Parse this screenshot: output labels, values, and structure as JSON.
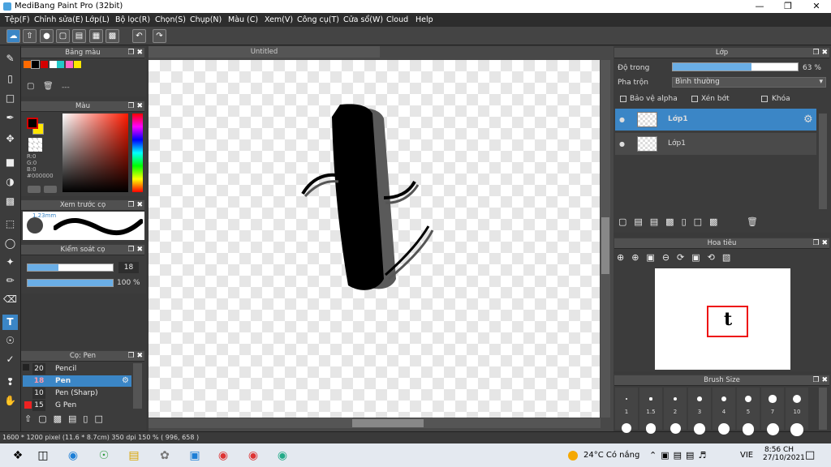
{
  "app": {
    "title": "MediBang Paint Pro (32bit)"
  },
  "menu": [
    "Tệp(F)",
    "Chỉnh sửa(E)",
    "Lớp(L)",
    "Bộ lọc(R)",
    "Chọn(S)",
    "Chụp(N)",
    "Màu (C)",
    "Xem(V)",
    "Công cụ(T)",
    "Cửa sổ(W)",
    "Cloud",
    "Help"
  ],
  "palette": {
    "title": "Bảng màu",
    "add_label": "---",
    "colors": [
      "#ff6a00",
      "#000000",
      "#d60000",
      "#ffffff",
      "#22c9c9",
      "#ff66c8",
      "#ffe600"
    ]
  },
  "color_panel": {
    "title": "Màu",
    "r": "R:0",
    "g": "G:0",
    "b": "B:0",
    "hex": "#000000"
  },
  "brush_preview": {
    "title": "Xem trước cọ",
    "size": "1.23mm"
  },
  "brush_control": {
    "title": "Kiểm soát cọ",
    "size": "18",
    "opacity": "100 %",
    "opacity_value": 1.0
  },
  "brush_list": {
    "title": "Cọ: Pen",
    "items": [
      {
        "size": "20",
        "name": "Pencil"
      },
      {
        "size": "18",
        "name": "Pen"
      },
      {
        "size": "10",
        "name": "Pen (Sharp)"
      },
      {
        "size": "15",
        "name": "G Pen"
      }
    ]
  },
  "document": {
    "tab": "Untitled"
  },
  "status": {
    "text": "1600 * 1200 pixel  (11.6 * 8.7cm)  350 dpi  150 %  ( 996, 658 )"
  },
  "layer_panel": {
    "title": "Lớp",
    "opacity_label": "Độ trong",
    "opacity": "63 %",
    "opacity_value": 0.63,
    "blend_label": "Pha trộn",
    "blend_value": "Bình thường",
    "alpha_label": "Bảo vệ alpha",
    "clip_label": "Xén bớt",
    "lock_label": "Khóa",
    "layers": [
      {
        "name": "Lớp1"
      },
      {
        "name": "Lớp1"
      }
    ]
  },
  "navigator": {
    "title": "Hoa tiêu"
  },
  "brush_size": {
    "title": "Brush Size",
    "sizes": [
      "1",
      "1.5",
      "2",
      "3",
      "4",
      "5",
      "7",
      "10"
    ]
  },
  "taskbar": {
    "weather": "24°C  Có nắng",
    "lang": "VIE",
    "time": "8:56 CH",
    "date": "27/10/2021"
  }
}
